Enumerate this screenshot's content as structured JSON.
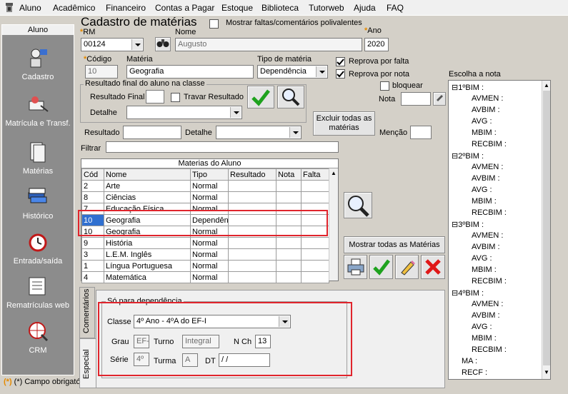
{
  "menu": [
    "Aluno",
    "Acadêmico",
    "Financeiro",
    "Contas a Pagar",
    "Estoque",
    "Biblioteca",
    "Tutorweb",
    "Ajuda",
    "FAQ"
  ],
  "sidebar": {
    "header": "Aluno",
    "items": [
      {
        "label": "Cadastro",
        "icon": "student-registration-icon"
      },
      {
        "label": "Matrícula e Transf.",
        "icon": "enrollment-icon"
      },
      {
        "label": "Matérias",
        "icon": "subjects-icon"
      },
      {
        "label": "Histórico",
        "icon": "history-books-icon"
      },
      {
        "label": "Entrada/saída",
        "icon": "alarm-clock-icon"
      },
      {
        "label": "Rematrículas web",
        "icon": "web-reenrollment-icon"
      },
      {
        "label": "CRM",
        "icon": "crm-globe-icon"
      }
    ]
  },
  "footer_note": "(*) Campo obrigatório",
  "form": {
    "title": "Cadastro de matérias",
    "show_comments_label": "Mostrar faltas/comentários polivalentes",
    "rm_label": "RM",
    "rm_value": "00124",
    "nome_label": "Nome",
    "nome_value": "Augusto",
    "ano_label": "Ano",
    "ano_value": "2020",
    "codigo_label": "Código",
    "codigo_value": "10",
    "materia_label": "Matéria",
    "materia_value": "Geografia",
    "tipo_label": "Tipo de matéria",
    "tipo_value": "Dependência",
    "reprova_falta_label": "Reprova por falta",
    "reprova_nota_label": "Reprova por nota",
    "bloquear_label": "bloquear",
    "nota_label": "Nota",
    "result_group_label": "Resultado final do aluno na classe",
    "resultado_final_label": "Resultado Final",
    "travar_label": "Travar Resultado",
    "detalhe_label": "Detalhe",
    "excluir_label_1": "Excluir todas as",
    "excluir_label_2": "matérias",
    "resultado_label": "Resultado",
    "detalhe2_label": "Detalhe",
    "mencao_label": "Menção",
    "filtrar_label": "Filtrar",
    "mostrar_todas_label": "Mostrar todas as Matérias"
  },
  "table": {
    "caption": "Materias do Aluno",
    "headers": [
      "Cód",
      "Nome",
      "Tipo",
      "Resultado",
      "Nota",
      "Falta"
    ],
    "rows": [
      [
        "2",
        "Arte",
        "Normal",
        "",
        "",
        ""
      ],
      [
        "8",
        "Ciências",
        "Normal",
        "",
        "",
        ""
      ],
      [
        "7",
        "Educação Física",
        "Normal",
        "",
        "",
        ""
      ],
      [
        "10",
        "Geografia",
        "Dependência",
        "",
        "",
        ""
      ],
      [
        "10",
        "Geografia",
        "Normal",
        "",
        "",
        ""
      ],
      [
        "9",
        "História",
        "Normal",
        "",
        "",
        ""
      ],
      [
        "3",
        "L.E.M. Inglês",
        "Normal",
        "",
        "",
        ""
      ],
      [
        "1",
        "Língua Portuguesa",
        "Normal",
        "",
        "",
        ""
      ],
      [
        "4",
        "Matemática",
        "Normal",
        "",
        "",
        ""
      ]
    ]
  },
  "tabs": {
    "comentarios": "Comentários",
    "especial": "Especial"
  },
  "dependencia": {
    "group_label": "Só para dependência",
    "classe_label": "Classe",
    "classe_value": "4º Ano - 4ºA do EF-I",
    "grau_label": "Grau",
    "grau_value": "EF-I",
    "turno_label": "Turno",
    "turno_value": "Integral",
    "nch_label": "N Ch",
    "nch_value": "13",
    "serie_label": "Série",
    "serie_value": "4º",
    "turma_label": "Turma",
    "turma_value": "A",
    "dt_label": "DT",
    "dt_value": " / /"
  },
  "nota_panel": {
    "title": "Escolha a nota",
    "tree": [
      {
        "group": "1ºBIM :",
        "children": [
          "AVMEN :",
          "AVBIM :",
          "AVG :",
          "MBIM :",
          "RECBIM :"
        ]
      },
      {
        "group": "2ºBIM :",
        "children": [
          "AVMEN :",
          "AVBIM :",
          "AVG :",
          "MBIM :",
          "RECBIM :"
        ]
      },
      {
        "group": "3ºBIM :",
        "children": [
          "AVMEN :",
          "AVBIM :",
          "AVG :",
          "MBIM :",
          "RECBIM :"
        ]
      },
      {
        "group": "4ºBIM :",
        "children": [
          "AVMEN :",
          "AVBIM :",
          "AVG :",
          "MBIM :",
          "RECBIM :"
        ]
      }
    ],
    "tail": [
      "MA :",
      "RECF :"
    ]
  },
  "colors": {
    "highlight": "#e0242c",
    "check_green": "#1ea21e",
    "delete_red": "#e01818"
  }
}
